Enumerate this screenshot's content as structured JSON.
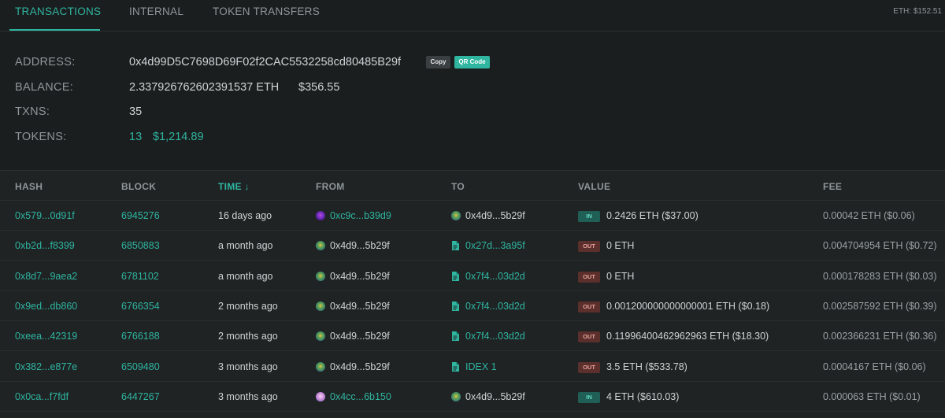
{
  "tabs": [
    {
      "label": "TRANSACTIONS"
    },
    {
      "label": "INTERNAL"
    },
    {
      "label": "TOKEN TRANSFERS"
    }
  ],
  "eth_price": "ETH: $152.51",
  "summary": {
    "address_label": "ADDRESS:",
    "address": "0x4d99D5C7698D69F02f2CAC5532258cd80485B29f",
    "copy_label": "Copy",
    "qr_label": "QR Code",
    "balance_label": "BALANCE:",
    "balance_eth": "2.337926762602391537 ETH",
    "balance_usd": "$356.55",
    "txns_label": "TXNS:",
    "txns": "35",
    "tokens_label": "TOKENS:",
    "tokens_count": "13",
    "tokens_usd": "$1,214.89"
  },
  "table": {
    "headers": {
      "hash": "HASH",
      "block": "BLOCK",
      "time": "TIME ↓",
      "from": "FROM",
      "to": "TO",
      "value": "VALUE",
      "fee": "FEE"
    },
    "rows": [
      {
        "hash": "0x579...0d91f",
        "block": "6945276",
        "time": "16 days ago",
        "from": "0xc9c...b39d9",
        "to": "0x4d9...5b29f",
        "direction": "IN",
        "value": "0.2426 ETH ($37.00)",
        "fee": "0.00042 ETH ($0.06)"
      },
      {
        "hash": "0xb2d...f8399",
        "block": "6850883",
        "time": "a month ago",
        "from": "0x4d9...5b29f",
        "to": "0x27d...3a95f",
        "direction": "OUT",
        "value": "0 ETH",
        "fee": "0.004704954 ETH ($0.72)"
      },
      {
        "hash": "0x8d7...9aea2",
        "block": "6781102",
        "time": "a month ago",
        "from": "0x4d9...5b29f",
        "to": "0x7f4...03d2d",
        "direction": "OUT",
        "value": "0 ETH",
        "fee": "0.000178283 ETH ($0.03)"
      },
      {
        "hash": "0x9ed...db860",
        "block": "6766354",
        "time": "2 months ago",
        "from": "0x4d9...5b29f",
        "to": "0x7f4...03d2d",
        "direction": "OUT",
        "value": "0.001200000000000001 ETH ($0.18)",
        "fee": "0.002587592 ETH ($0.39)"
      },
      {
        "hash": "0xeea...42319",
        "block": "6766188",
        "time": "2 months ago",
        "from": "0x4d9...5b29f",
        "to": "0x7f4...03d2d",
        "direction": "OUT",
        "value": "0.11996400462962963 ETH ($18.30)",
        "fee": "0.002366231 ETH ($0.36)"
      },
      {
        "hash": "0x382...e877e",
        "block": "6509480",
        "time": "3 months ago",
        "from": "0x4d9...5b29f",
        "to": "IDEX 1",
        "direction": "OUT",
        "value": "3.5 ETH ($533.78)",
        "fee": "0.0004167 ETH ($0.06)"
      },
      {
        "hash": "0x0ca...f7fdf",
        "block": "6447267",
        "time": "3 months ago",
        "from": "0x4cc...6b150",
        "to": "0x4d9...5b29f",
        "direction": "IN",
        "value": "4 ETH ($610.03)",
        "fee": "0.000063 ETH ($0.01)"
      }
    ]
  },
  "colors": {
    "accent": "#2fb5a0",
    "background": "#1b1e1f",
    "in_badge": "#1f5f55",
    "out_badge": "#5a2f2c"
  }
}
